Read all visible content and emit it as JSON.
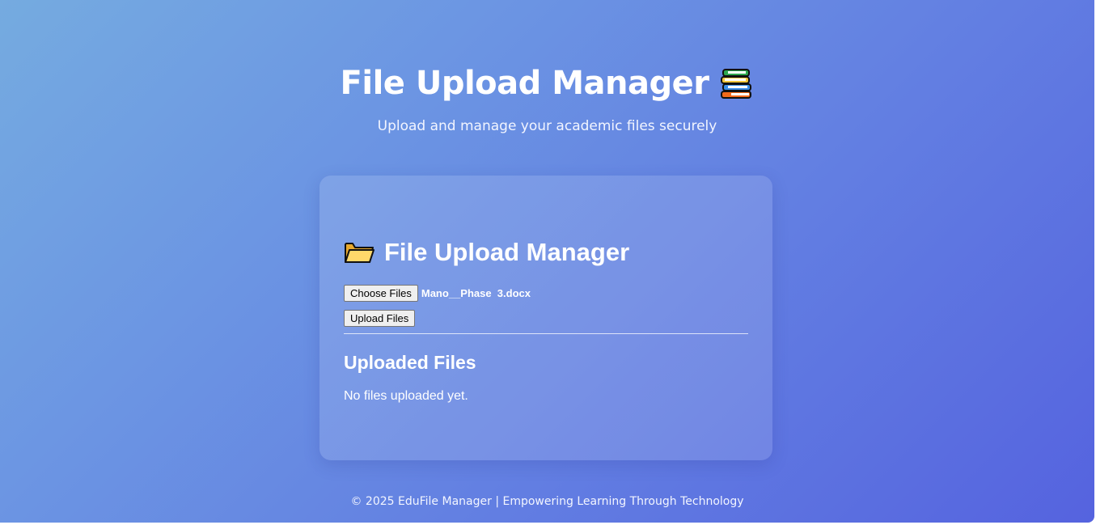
{
  "header": {
    "title": "File Upload Manager",
    "title_icon": "books-icon",
    "subtitle": "Upload and manage your academic files securely"
  },
  "card": {
    "title": "File Upload Manager",
    "title_icon": "folder-icon",
    "choose_files_label": "Choose Files",
    "selected_file_name": "Mano__Phase  3.docx",
    "upload_button_label": "Upload Files",
    "uploaded_section_title": "Uploaded Files",
    "empty_message": "No files uploaded yet."
  },
  "footer": {
    "text": "© 2025 EduFile Manager | Empowering Learning Through Technology"
  },
  "colors": {
    "gradient_start": "#75abe0",
    "gradient_end": "#5563df",
    "text": "#ffffff"
  }
}
